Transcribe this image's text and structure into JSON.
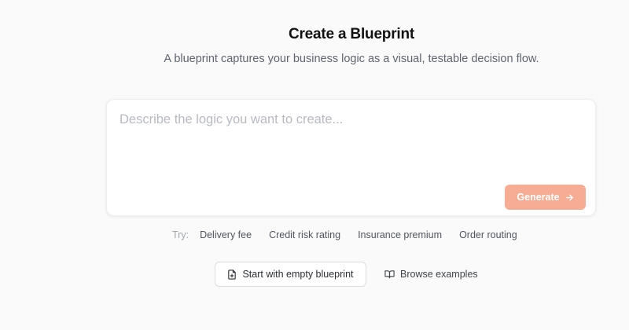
{
  "header": {
    "title": "Create a Blueprint",
    "subtitle": "A blueprint captures your business logic as a visual, testable decision flow."
  },
  "prompt": {
    "placeholder": "Describe the logic you want to create...",
    "value": ""
  },
  "generate_button": {
    "label": "Generate",
    "icon": "arrow-right-icon",
    "color": "#f6ad94"
  },
  "suggestions": {
    "label": "Try:",
    "items": [
      {
        "label": "Delivery fee"
      },
      {
        "label": "Credit risk rating"
      },
      {
        "label": "Insurance premium"
      },
      {
        "label": "Order routing"
      }
    ]
  },
  "actions": {
    "empty": {
      "label": "Start with empty blueprint",
      "icon": "file-plus-icon"
    },
    "browse": {
      "label": "Browse examples",
      "icon": "book-open-icon"
    }
  }
}
